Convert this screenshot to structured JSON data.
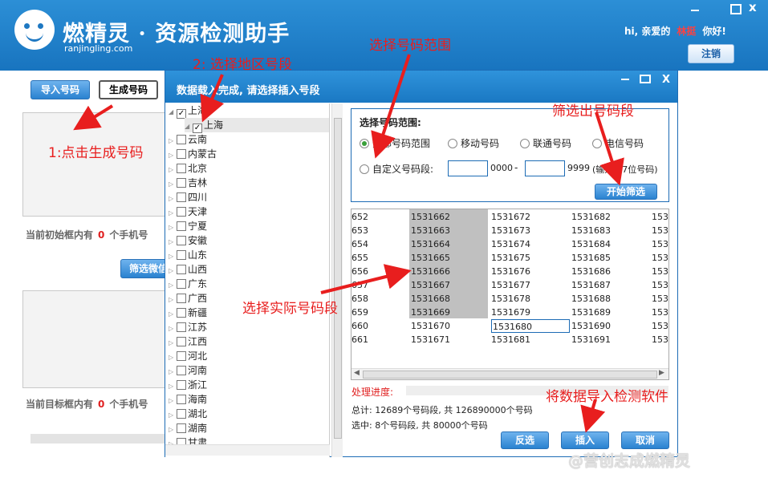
{
  "app": {
    "name": "燃精灵 · 资源检测助手",
    "domain": "ranjingling.com"
  },
  "header": {
    "greeting_prefix": "hi, 亲爱的",
    "username": "林挺",
    "greeting_suffix": "你好!",
    "logout_label": "注销"
  },
  "window_controls": {
    "close": "x"
  },
  "main": {
    "import_label": "导入号码",
    "generate_label": "生成号码",
    "filter_wechat_label": "筛选微信",
    "initial_count_prefix": "当前初始框内有",
    "initial_count": "0",
    "initial_count_suffix": "个手机号",
    "target_count_prefix": "当前目标框内有",
    "target_count": "0",
    "target_count_suffix": "个手机号"
  },
  "dialog": {
    "title": "数据载入完成, 请选择插入号段",
    "controls": {
      "close": "X"
    },
    "tree": {
      "root": {
        "label": "上海",
        "checked": true
      },
      "child": {
        "label": "上海",
        "checked": true
      },
      "provinces": [
        "云南",
        "内蒙古",
        "北京",
        "吉林",
        "四川",
        "天津",
        "宁夏",
        "安徽",
        "山东",
        "山西",
        "广东",
        "广西",
        "新疆",
        "江苏",
        "江西",
        "河北",
        "河南",
        "浙江",
        "海南",
        "湖北",
        "湖南",
        "甘肃"
      ]
    },
    "range": {
      "heading": "选择号码范围:",
      "options": [
        "全部号码范围",
        "移动号码",
        "联通号码",
        "电信号码"
      ],
      "selected": "全部号码范围",
      "custom_label": "自定义号码段:",
      "from_value": "",
      "from_suffix": "0000",
      "dash": "-",
      "to_value": "",
      "to_suffix": "9999",
      "hint": "(输入前7位号码)",
      "filter_button": "开始筛选"
    },
    "grid": {
      "columns": [
        [
          "652",
          "653",
          "654",
          "655",
          "656",
          "657",
          "658",
          "659",
          "660",
          "661"
        ],
        [
          "1531662",
          "1531663",
          "1531664",
          "1531665",
          "1531666",
          "1531667",
          "1531668",
          "1531669",
          "1531670",
          "1531671"
        ],
        [
          "1531672",
          "1531673",
          "1531674",
          "1531675",
          "1531676",
          "1531677",
          "1531678",
          "1531679",
          "1531680",
          "1531681"
        ],
        [
          "1531682",
          "1531683",
          "1531684",
          "1531685",
          "1531686",
          "1531687",
          "1531688",
          "1531689",
          "1531690",
          "1531691"
        ],
        [
          "153",
          "153",
          "153",
          "153",
          "153",
          "153",
          "153",
          "153",
          "153",
          "153"
        ]
      ],
      "selected_cells": "column 2, rows 1-8",
      "focused_cell": "1531680"
    },
    "progress_label": "处理进度:",
    "progress_fraction": 0,
    "total_text": "总计: 12689个号码段, 共 126890000个号码",
    "selected_text": "选中: 8个号码段, 共 80000个号码",
    "buttons": {
      "invert": "反选",
      "insert": "插入",
      "cancel": "取消"
    }
  },
  "annotations": {
    "step1": "1:点击生成号码",
    "step2": "2: 选择地区号段",
    "range": "选择号码范围",
    "filter": "筛选出号码段",
    "actual": "选择实际号码段",
    "import": "将数据导入检测软件"
  },
  "watermark": "@营创志成燃精灵",
  "colors": {
    "header_blue": "#1e7ec8",
    "accent_red": "#e81e1e",
    "button_blue": "#2a82d0"
  }
}
